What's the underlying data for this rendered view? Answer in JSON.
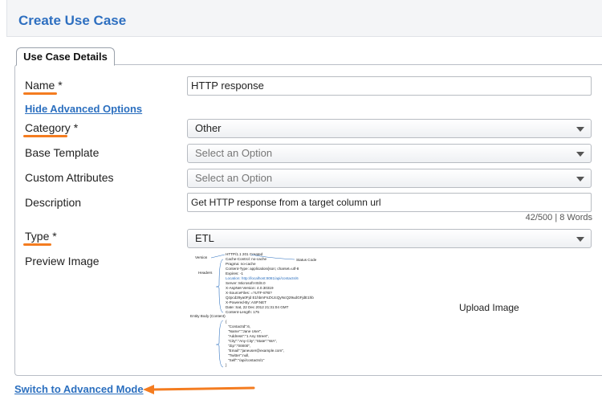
{
  "header": {
    "title": "Create Use Case"
  },
  "tab": {
    "label": "Use Case Details"
  },
  "fields": {
    "name": {
      "label": "Name *",
      "value": "HTTP response"
    },
    "hide_advanced_link": "Hide Advanced Options",
    "category": {
      "label": "Category *",
      "value": "Other"
    },
    "base_template": {
      "label": "Base Template",
      "value": "Select an Option"
    },
    "custom_attributes": {
      "label": "Custom Attributes",
      "value": "Select an Option"
    },
    "description": {
      "label": "Description",
      "value": "Get HTTP response from a target column url",
      "counter": "42/500 | 8 Words"
    },
    "type": {
      "label": "Type *",
      "value": "ETL"
    },
    "preview_image": {
      "label": "Preview Image",
      "upload_label": "Upload Image"
    }
  },
  "preview": {
    "left_labels": [
      "Version",
      "Headers",
      "Entity Body (Content)"
    ],
    "right_labels": [
      "Status Code"
    ],
    "headers_lines": [
      "HTTP/1.1 201 Created",
      "Cache-Control: no-cache",
      "Pragma: no-cache",
      "Content-Type: application/json; charset=utf-8",
      "Expires: -1",
      "Location: http://localhost:8081/api/contacts/6",
      "Server: Microsoft-IIS/8.0",
      "X-AspNet-Version: 4.0.30319",
      "X-SourceFiles: =?UTF-8?B?",
      "Qzpcd29ya0Fjd E1hbmFnZXJcQyNcQ29udGFjdE1hb",
      "X-Powered-By: ASP.NET",
      "Date: Sat, 22 Dec 2012 21:31:04 GMT",
      "Content-Length: 175"
    ],
    "body_lines": [
      "{",
      "\"ContactId\":6,",
      "\"Name\":\"Jane User\",",
      "\"Address\":\"1 Any Street\",",
      "\"City\":\"Any City\",\"State\":\"WA\",",
      "\"Zip\":\"00000\",",
      "\"Email\":\"janeuser@example.com\",",
      "\"Twitter\":null,",
      "\"Self\":\"/api/contacts/1\"",
      "}"
    ]
  },
  "footer": {
    "advanced_mode_link": "Switch to Advanced Mode"
  },
  "colors": {
    "accent": "#f47c20",
    "link": "#2b6fbf",
    "title": "#2e6fc0"
  }
}
